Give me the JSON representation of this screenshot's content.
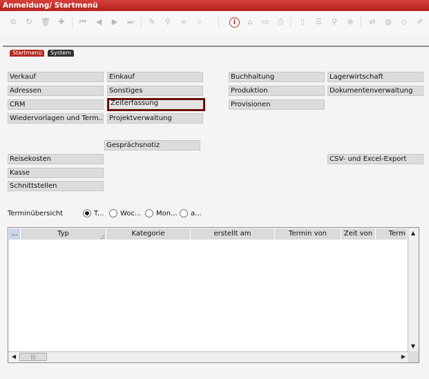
{
  "window": {
    "title": "Anmeldung/ Startmenü"
  },
  "toolbar": {
    "icons": [
      "copy-icon",
      "refresh-icon",
      "delete-icon",
      "add-icon",
      "first-icon",
      "prev-icon",
      "next-icon",
      "last-icon",
      "edit-icon",
      "filter-icon",
      "binoculars-icon",
      "search-icon",
      "info-icon",
      "home-icon",
      "window-icon",
      "print-icon",
      "print-preview-icon",
      "list-icon",
      "save-icon",
      "find-icon",
      "zoom-icon",
      "transfer-icon",
      "globe-icon",
      "tag-icon",
      "pen-icon"
    ]
  },
  "tabs": [
    {
      "label": "Startmenü",
      "active": true
    },
    {
      "label": "System",
      "active": false
    }
  ],
  "menu": {
    "verkauf": "Verkauf",
    "einkauf": "Einkauf",
    "buchhaltung": "Buchhaltung",
    "lagerwirtschaft": "Lagerwirtschaft",
    "adressen": "Adressen",
    "sonstiges": "Sonstiges",
    "produktion": "Produktion",
    "dokumentenverwaltung": "Dokumentenverwaltung",
    "crm": "CRM",
    "zeiterfassung": "Zeiterfassung",
    "provisionen": "Provisionen",
    "wiedervorlagen": "Wiedervorlagen und Term...",
    "projektverwaltung": "Projektverwaltung",
    "gespraechsnotiz": "Gesprächsnotiz",
    "reisekosten": "Reisekosten",
    "csv_export": "CSV- und Excel-Export",
    "kasse": "Kasse",
    "schnittstellen": "Schnittstellen"
  },
  "terminuebersicht": {
    "label": "Terminübersicht",
    "options": [
      "T...",
      "Woc...",
      "Mon...",
      "a..."
    ],
    "selected_index": 0
  },
  "grid": {
    "columns": [
      "...",
      "Typ",
      "Kategorie",
      "erstellt am",
      "Termin von",
      "Zeit von",
      "Term"
    ],
    "rows": []
  },
  "colors": {
    "title_bar": "#b3231c",
    "highlight_border": "#6c0b0b"
  }
}
